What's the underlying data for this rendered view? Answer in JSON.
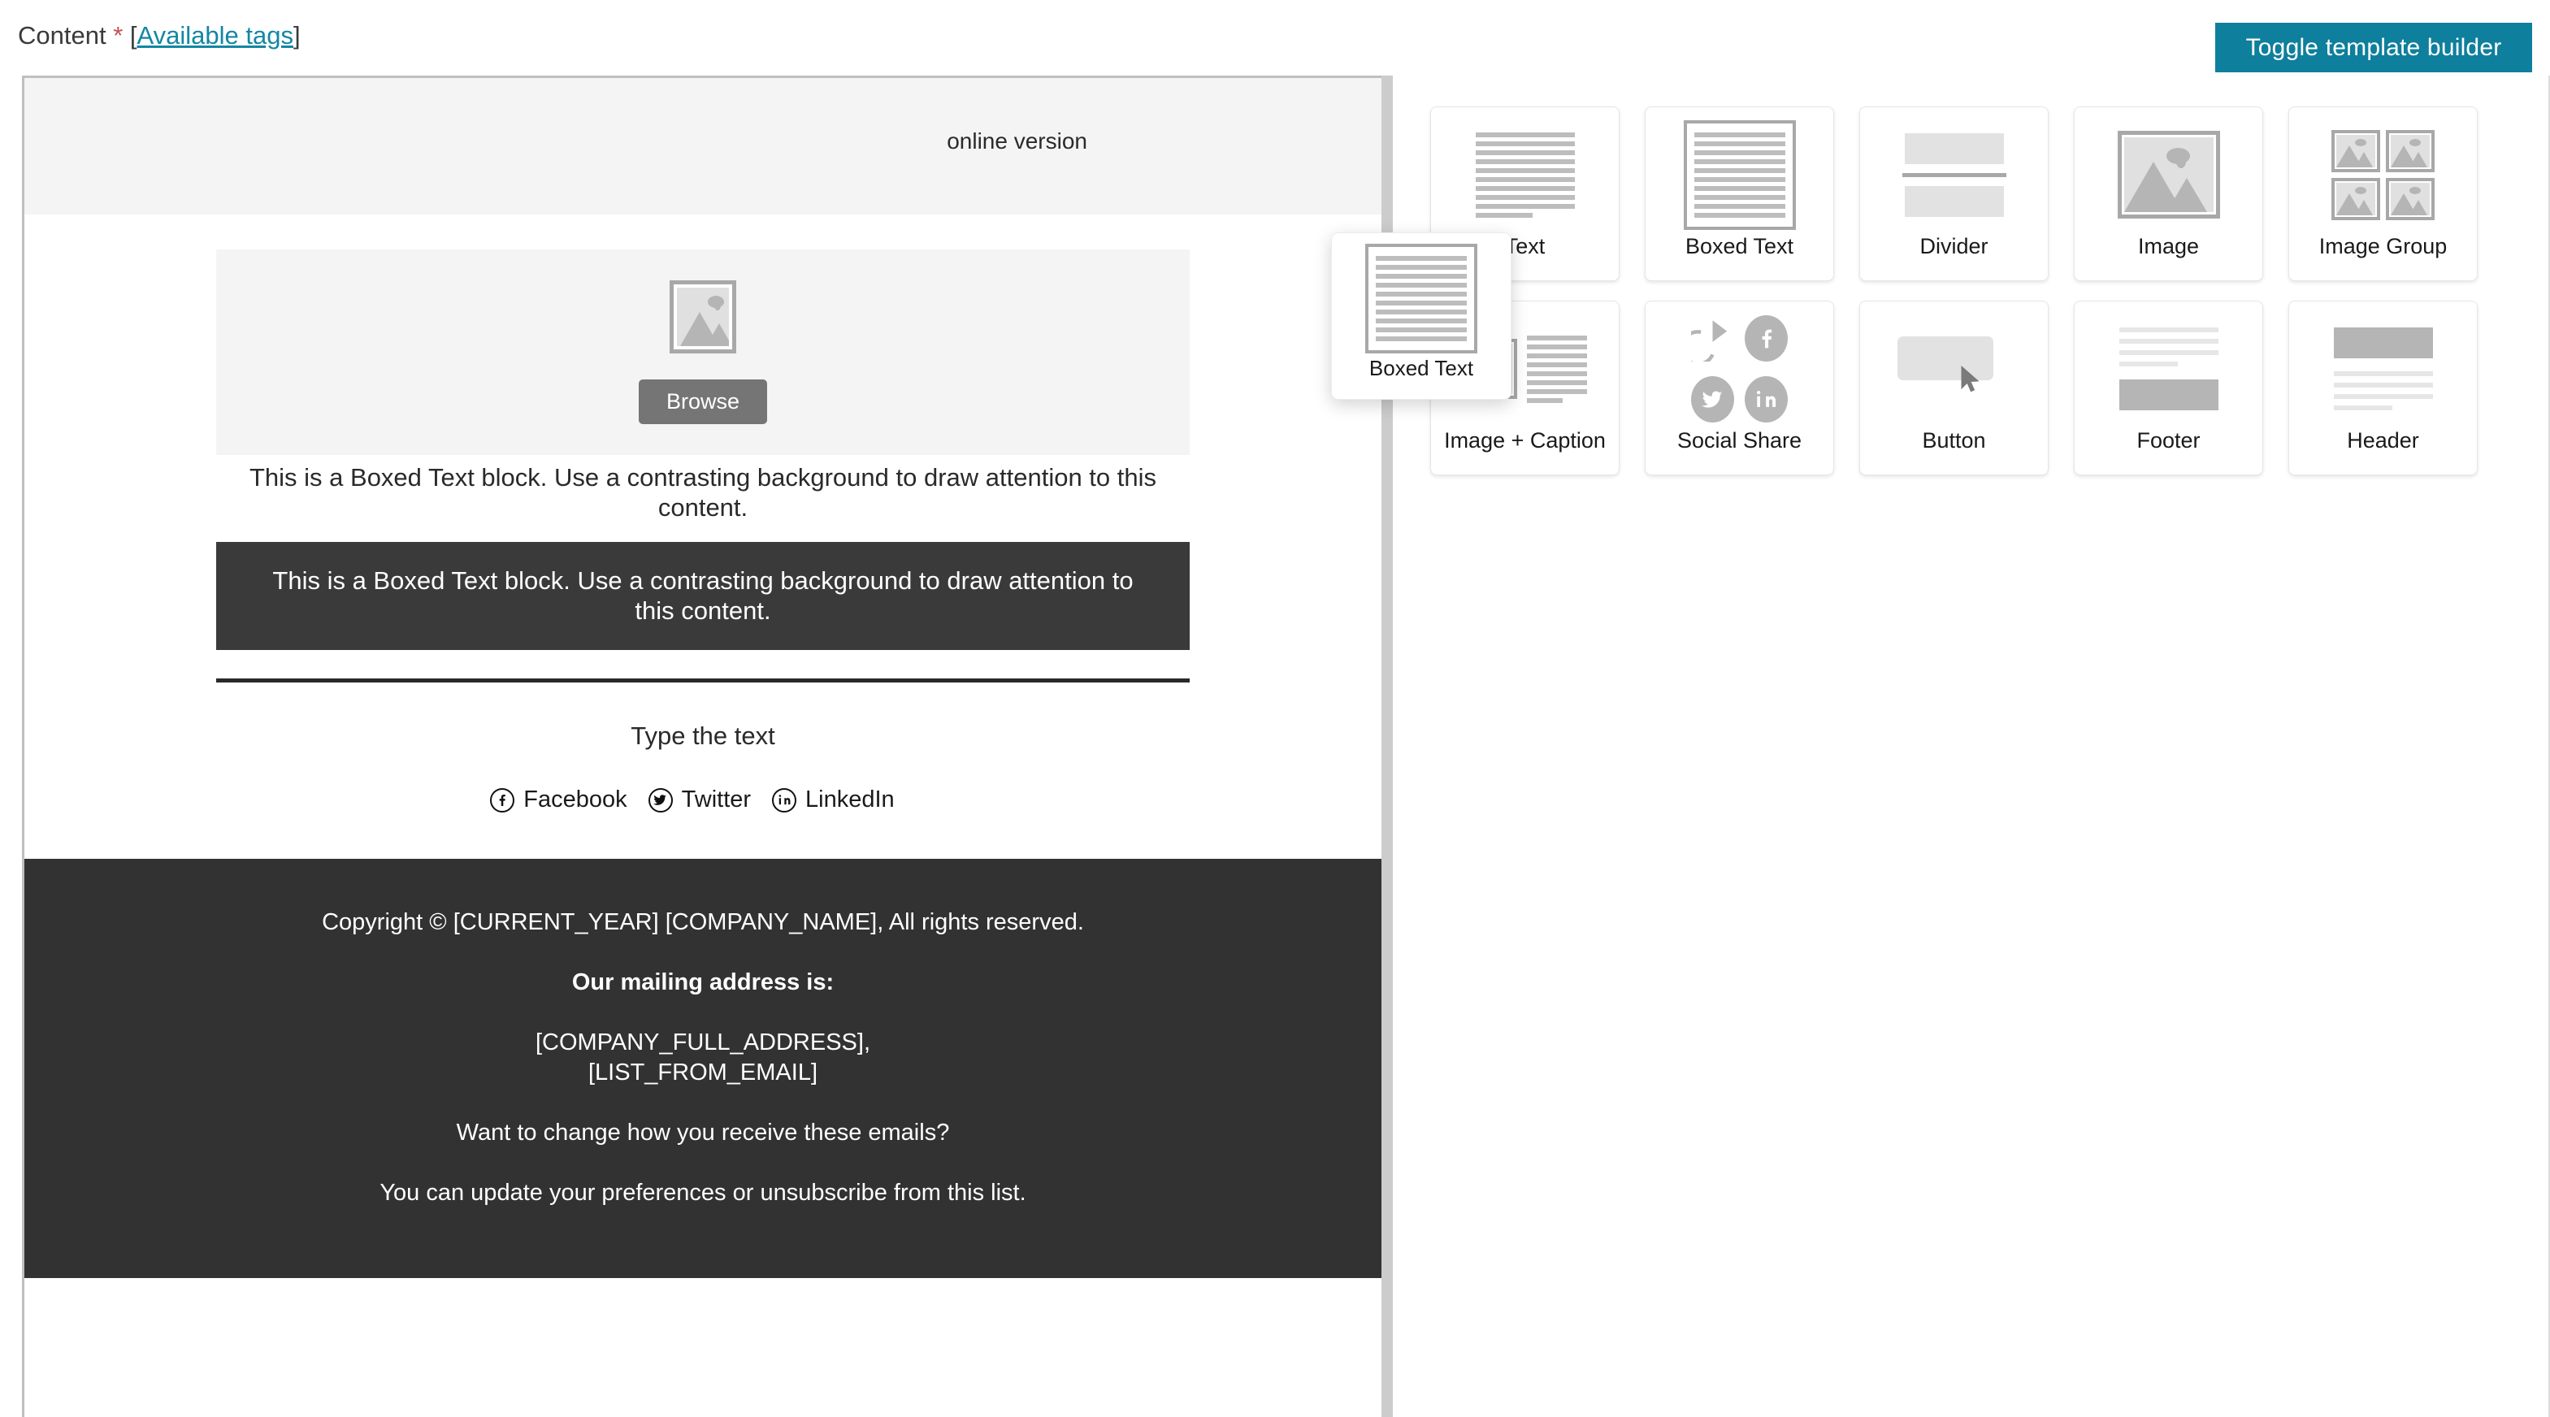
{
  "topbar": {
    "content_label": "Content",
    "required_marker": "*",
    "available_tags_open": "[",
    "available_tags": "Available tags",
    "available_tags_close": "]",
    "toggle_button": "Toggle template builder",
    "accent_color": "#0e7f9c",
    "link_color": "#1387a2",
    "required_color": "#c0504d"
  },
  "preview": {
    "header": {
      "online_version": "online version"
    },
    "image_block": {
      "browse_button": "Browse",
      "placeholder_icon": "image-placeholder-icon"
    },
    "plain_text": "This is a Boxed Text block. Use a contrasting background to draw attention to this content.",
    "boxed_text": "This is a Boxed Text block. Use a contrasting background to draw attention to this content.",
    "boxed_text_bg": "#3a3a3a",
    "type_text": "Type the text",
    "social": [
      {
        "icon": "facebook-icon",
        "glyph": "f",
        "label": "Facebook"
      },
      {
        "icon": "twitter-icon",
        "glyph": "✔",
        "label": "Twitter"
      },
      {
        "icon": "linkedin-icon",
        "glyph": "in",
        "label": "LinkedIn"
      }
    ],
    "footer": {
      "bg": "#323232",
      "lines": [
        {
          "text": "Copyright © [CURRENT_YEAR] [COMPANY_NAME], All rights reserved.",
          "bold": false
        },
        {
          "text": "Our mailing address is:",
          "bold": true
        },
        {
          "text": "[COMPANY_FULL_ADDRESS],\n[LIST_FROM_EMAIL]",
          "bold": false
        },
        {
          "text": "Want to change how you receive these emails?",
          "bold": false
        },
        {
          "text": "You can update your preferences or unsubscribe from this list.",
          "bold": false
        }
      ]
    }
  },
  "palette": {
    "tiles": [
      {
        "label": "Text",
        "art": "text"
      },
      {
        "label": "Boxed Text",
        "art": "boxed"
      },
      {
        "label": "Divider",
        "art": "divider"
      },
      {
        "label": "Image",
        "art": "image"
      },
      {
        "label": "Image Group",
        "art": "imagegroup"
      },
      {
        "label": "Image + Caption",
        "art": "imagecaption"
      },
      {
        "label": "Social Share",
        "art": "social"
      },
      {
        "label": "Button",
        "art": "button"
      },
      {
        "label": "Footer",
        "art": "footer"
      },
      {
        "label": "Header",
        "art": "header"
      }
    ],
    "drag_ghost": {
      "label": "Boxed Text",
      "art": "boxed"
    }
  }
}
